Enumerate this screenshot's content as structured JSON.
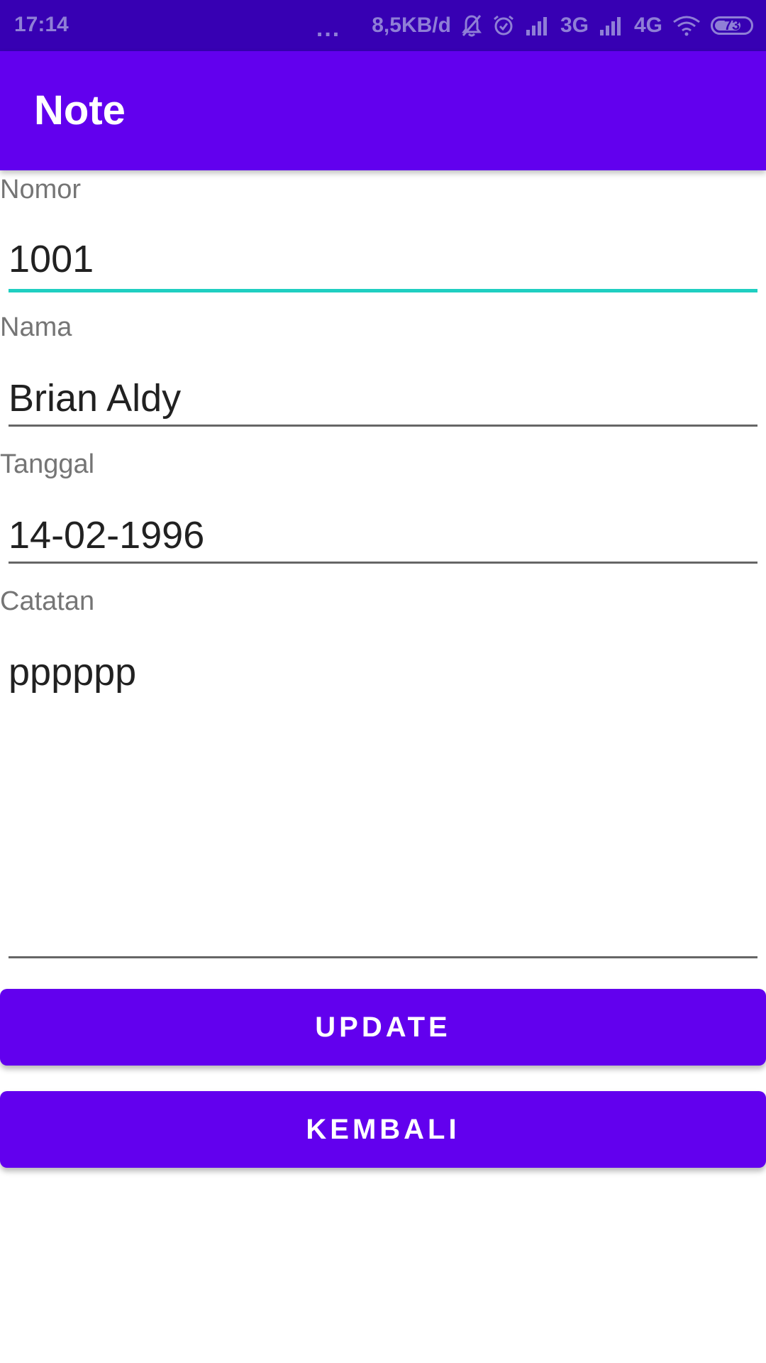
{
  "status_bar": {
    "time": "17:14",
    "more": "...",
    "network_speed": "8,5KB/d",
    "network_3g": "3G",
    "network_4g": "4G",
    "battery_level": "73",
    "icons": [
      "bell-off-icon",
      "alarm-icon",
      "signal-icon",
      "signal-icon",
      "wifi-icon",
      "battery-icon"
    ]
  },
  "app_bar": {
    "title": "Note"
  },
  "form": {
    "nomor": {
      "label": "Nomor",
      "value": "1001"
    },
    "nama": {
      "label": "Nama",
      "value": "Brian Aldy"
    },
    "tanggal": {
      "label": "Tanggal",
      "value": "14-02-1996"
    },
    "catatan": {
      "label": "Catatan",
      "value": "pppppp"
    }
  },
  "buttons": {
    "update": "UPDATE",
    "kembali": "KEMBALI"
  },
  "colors": {
    "status_bar": "#3700b3",
    "primary": "#6200ee",
    "focus_underline": "#1fcfc1",
    "label": "#757575"
  }
}
